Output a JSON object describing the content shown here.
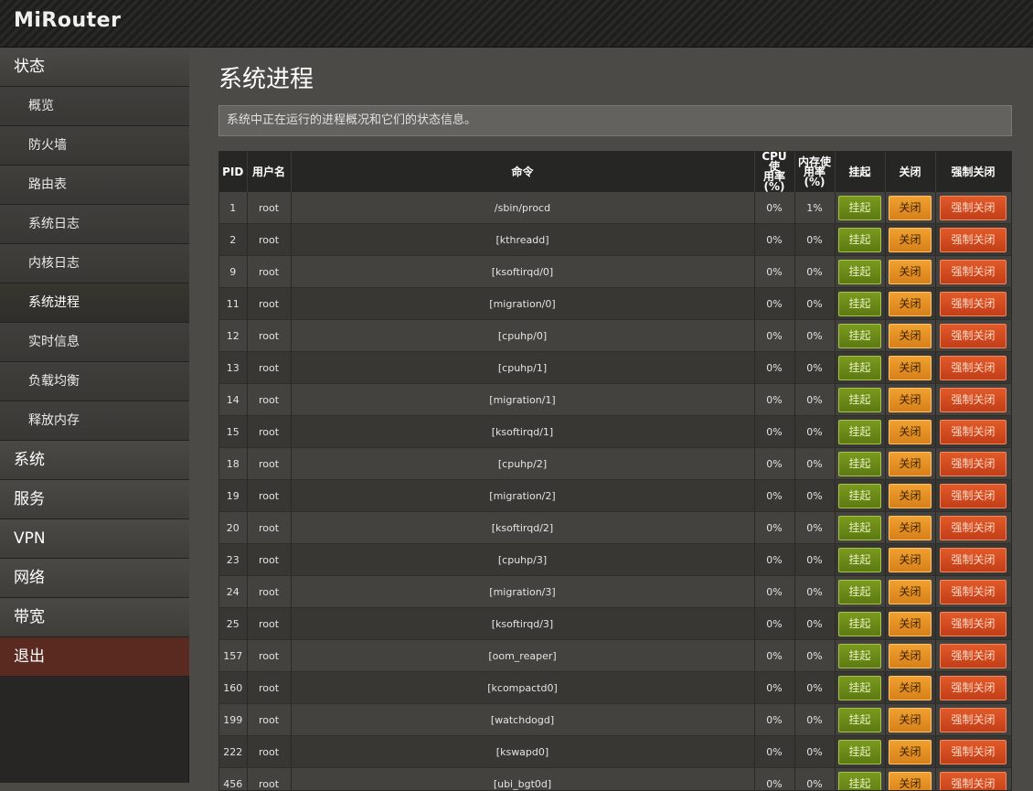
{
  "app": {
    "brand": "MiRouter"
  },
  "sidebar": {
    "status_label": "状态",
    "sub_items": [
      "概览",
      "防火墙",
      "路由表",
      "系统日志",
      "内核日志",
      "系统进程",
      "实时信息",
      "负载均衡",
      "释放内存"
    ],
    "active_sub": "系统进程",
    "top_items": [
      "系统",
      "服务",
      "VPN",
      "网络",
      "带宽"
    ],
    "logout_label": "退出"
  },
  "page": {
    "title": "系统进程",
    "description": "系统中正在运行的进程概况和它们的状态信息。"
  },
  "table": {
    "headers": {
      "pid": "PID",
      "user": "用户名",
      "command": "命令",
      "cpu_l1": "CPU 使",
      "cpu_l2": "用率",
      "cpu_l3": "(%)",
      "mem_l1": "内存使",
      "mem_l2": "用率",
      "mem_l3": "(%)",
      "suspend": "挂起",
      "close": "关闭",
      "force": "强制关闭"
    },
    "button_labels": {
      "suspend": "挂起",
      "close": "关闭",
      "force": "强制关闭"
    },
    "rows": [
      {
        "pid": "1",
        "user": "root",
        "command": "/sbin/procd",
        "cpu": "0%",
        "mem": "1%"
      },
      {
        "pid": "2",
        "user": "root",
        "command": "[kthreadd]",
        "cpu": "0%",
        "mem": "0%"
      },
      {
        "pid": "9",
        "user": "root",
        "command": "[ksoftirqd/0]",
        "cpu": "0%",
        "mem": "0%"
      },
      {
        "pid": "11",
        "user": "root",
        "command": "[migration/0]",
        "cpu": "0%",
        "mem": "0%"
      },
      {
        "pid": "12",
        "user": "root",
        "command": "[cpuhp/0]",
        "cpu": "0%",
        "mem": "0%"
      },
      {
        "pid": "13",
        "user": "root",
        "command": "[cpuhp/1]",
        "cpu": "0%",
        "mem": "0%"
      },
      {
        "pid": "14",
        "user": "root",
        "command": "[migration/1]",
        "cpu": "0%",
        "mem": "0%"
      },
      {
        "pid": "15",
        "user": "root",
        "command": "[ksoftirqd/1]",
        "cpu": "0%",
        "mem": "0%"
      },
      {
        "pid": "18",
        "user": "root",
        "command": "[cpuhp/2]",
        "cpu": "0%",
        "mem": "0%"
      },
      {
        "pid": "19",
        "user": "root",
        "command": "[migration/2]",
        "cpu": "0%",
        "mem": "0%"
      },
      {
        "pid": "20",
        "user": "root",
        "command": "[ksoftirqd/2]",
        "cpu": "0%",
        "mem": "0%"
      },
      {
        "pid": "23",
        "user": "root",
        "command": "[cpuhp/3]",
        "cpu": "0%",
        "mem": "0%"
      },
      {
        "pid": "24",
        "user": "root",
        "command": "[migration/3]",
        "cpu": "0%",
        "mem": "0%"
      },
      {
        "pid": "25",
        "user": "root",
        "command": "[ksoftirqd/3]",
        "cpu": "0%",
        "mem": "0%"
      },
      {
        "pid": "157",
        "user": "root",
        "command": "[oom_reaper]",
        "cpu": "0%",
        "mem": "0%"
      },
      {
        "pid": "160",
        "user": "root",
        "command": "[kcompactd0]",
        "cpu": "0%",
        "mem": "0%"
      },
      {
        "pid": "199",
        "user": "root",
        "command": "[watchdogd]",
        "cpu": "0%",
        "mem": "0%"
      },
      {
        "pid": "222",
        "user": "root",
        "command": "[kswapd0]",
        "cpu": "0%",
        "mem": "0%"
      },
      {
        "pid": "456",
        "user": "root",
        "command": "[ubi_bgt0d]",
        "cpu": "0%",
        "mem": "0%"
      }
    ]
  },
  "colors": {
    "suspend": "#6a8a18",
    "close": "#e8902a",
    "force": "#d24a20",
    "logout_bg": "#5a2a20"
  }
}
